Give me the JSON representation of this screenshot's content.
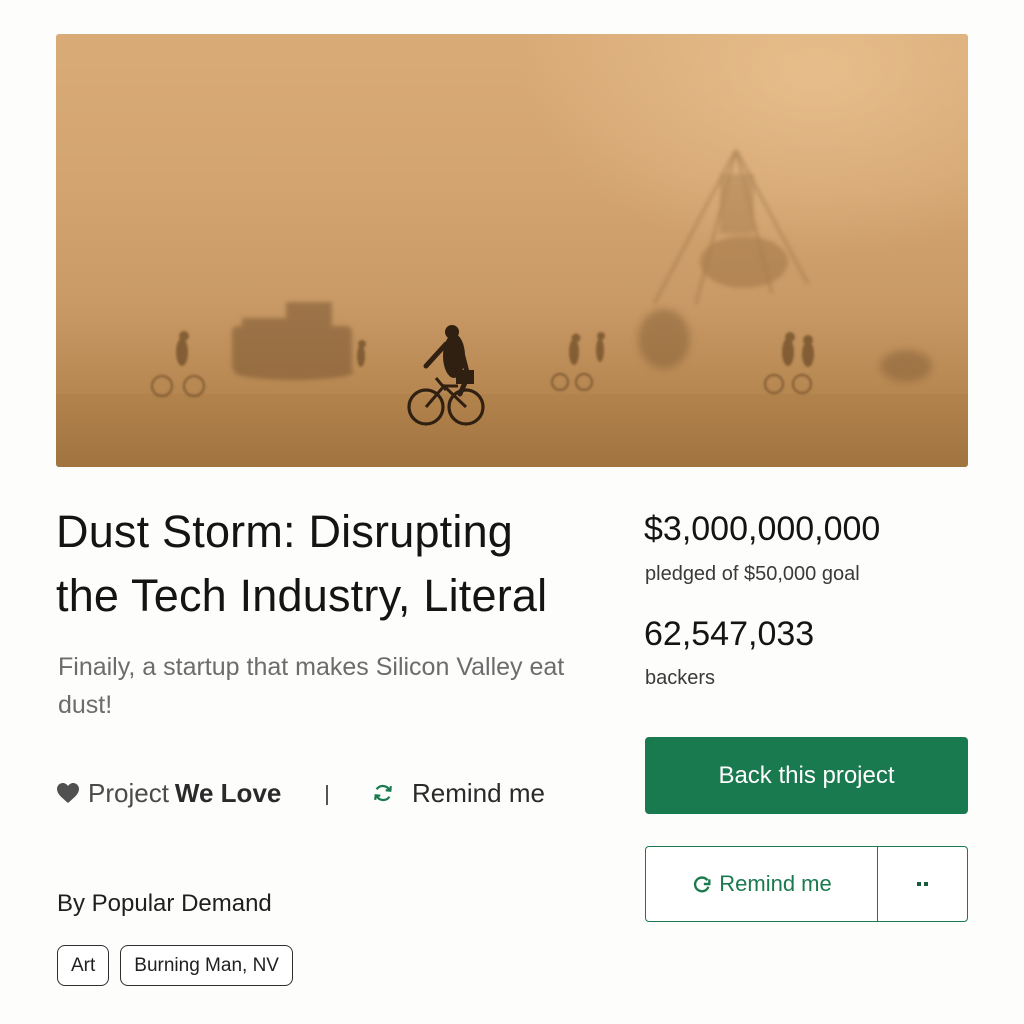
{
  "project": {
    "hero_alt": "Cyclists riding through a dust storm in the desert",
    "title_line1": "Dust Storm: Disrupting",
    "title_line2": "the Tech Industry, Literal",
    "blurb": "Finaily, a startup that makes Silicon Valley eat dust!",
    "badge_prefix": "Project",
    "badge_emphasis": "We Love",
    "badge_icon": "heart-icon",
    "remind_link_label": "Remind me",
    "remind_icon": "refresh-icon",
    "creator": "By Popular Demand",
    "tags": [
      "Art",
      "Burning Man, NV"
    ]
  },
  "stats": {
    "pledged": "$3,000,000,000",
    "pledged_label": "pledged of $50,000 goal",
    "backers": "62,547,033",
    "backers_label": "backers"
  },
  "actions": {
    "back_label": "Back this project",
    "remind_label": "Remind me",
    "more_icon": "more-icon"
  },
  "colors": {
    "accent": "#1a7a4f",
    "dust_light": "#d9ab77",
    "dust_dark": "#9c6f3c"
  }
}
